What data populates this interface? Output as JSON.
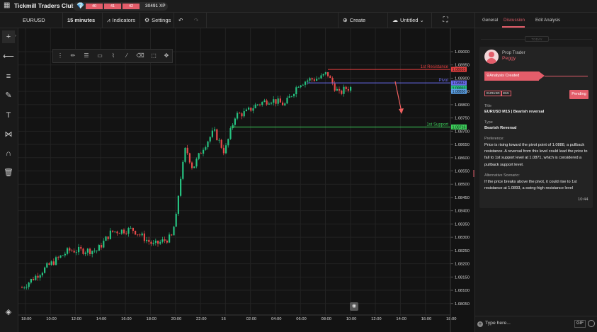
{
  "app": {
    "title": "Tickmill Traders Club",
    "xp_levels": [
      "40",
      "41",
      "42"
    ],
    "xp_text": "30491 XP"
  },
  "toolbar": {
    "symbol": "EURUSD",
    "timeframe": "15 minutes",
    "indicators": "Indicators",
    "settings": "Settings",
    "create_analysis": "Create Analysis",
    "untitled": "Untitled"
  },
  "chart_data": {
    "type": "candlestick",
    "symbol": "EURUSD",
    "y_ticks": [
      "1.09000",
      "1.08950",
      "1.08900",
      "1.08850",
      "1.08800",
      "1.08750",
      "1.08700",
      "1.08650",
      "1.08600",
      "1.08550",
      "1.08500",
      "1.08450",
      "1.08400",
      "1.08350",
      "1.08300",
      "1.08250",
      "1.08200",
      "1.08150",
      "1.08100",
      "1.08050"
    ],
    "x_ticks": [
      "18:00",
      "10:00",
      "12:00",
      "14:00",
      "16:00",
      "18:00",
      "20:00",
      "22:00",
      "16",
      "02:00",
      "04:00",
      "06:00",
      "08:00",
      "10:00",
      "12:00",
      "14:00",
      "16:00",
      "18:00"
    ],
    "ylim": [
      1.0802,
      1.0904
    ],
    "lines": [
      {
        "label": "1st Resistance",
        "price": 1.08933,
        "tag": "1.08933",
        "color": "#e84040"
      },
      {
        "label": "Pivot",
        "price": 1.08882,
        "tag": "1.08882",
        "color": "#6a6cf0"
      },
      {
        "label": "1st Support",
        "price": 1.08716,
        "tag": "1.08716",
        "color": "#3ccf5a"
      }
    ],
    "last_price_tags": [
      "1.08863",
      "1.08850"
    ],
    "candle_colors": {
      "up": "#26c281",
      "down": "#e84a4a"
    }
  },
  "panel": {
    "tabs": [
      "General",
      "Discussion",
      "Edit Analysis"
    ],
    "active_tab": "Discussion",
    "today": "TODAY",
    "card": {
      "role": "Prop Trader",
      "user": "Peggy",
      "status_banner": "Analysis Created",
      "badges": [
        "EURUSD",
        "M15"
      ],
      "status": "Pending",
      "title_label": "Title",
      "title_value": "EURUSD M15 | Bearish reversal",
      "type_label": "Type",
      "type_value": "Bearish Reversal",
      "pref_label": "Preference:",
      "pref_value": "Price is rising toward the pivot point of 1.0888, a pullback resistance. A reversal from this level could lead the price to fall to 1st  support level at 1.0871, which is considered a pullback support level.",
      "alt_label": "Alternative Scenario:",
      "alt_value": "If the price breaks above the pivot, it could rise to 1st resistance at 1.0893, a swing-high resistance level",
      "time": "10:44"
    },
    "input_placeholder": "Type here...",
    "gif": "GIF"
  }
}
